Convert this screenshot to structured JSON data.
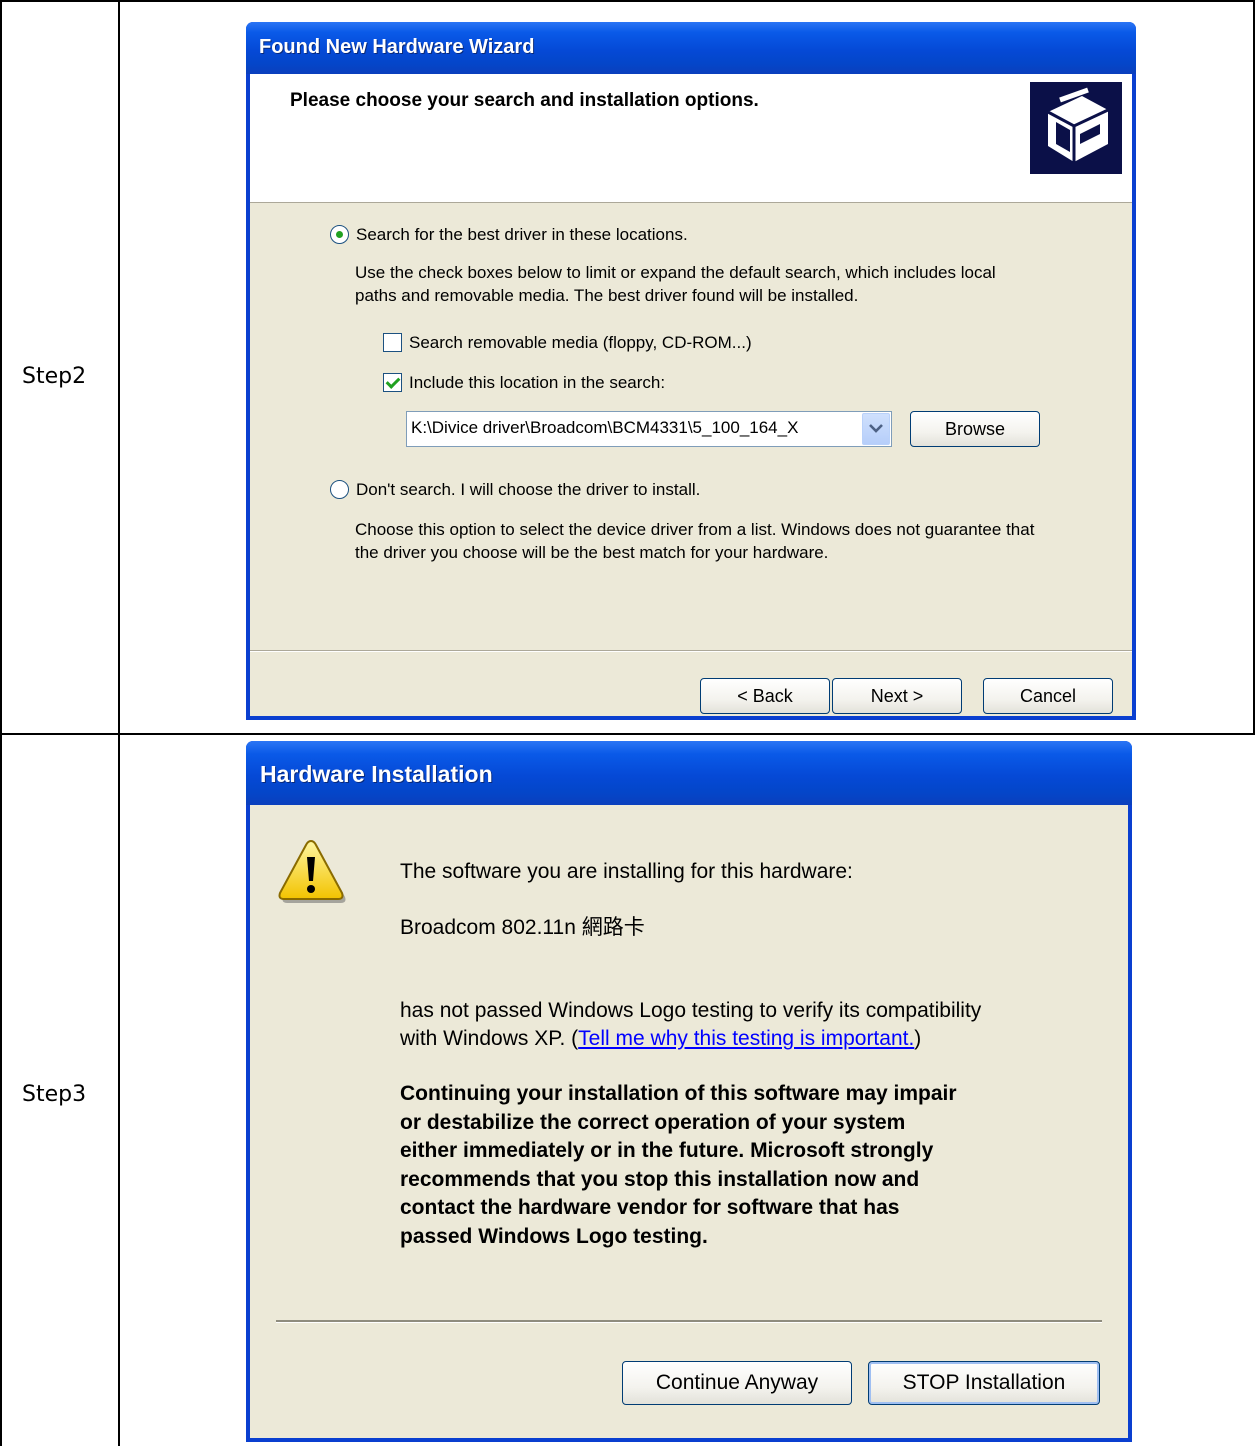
{
  "rows": [
    {
      "label": "Step2"
    },
    {
      "label": "Step3"
    }
  ],
  "wizard": {
    "title": "Found New Hardware Wizard",
    "header_title": "Please choose your search and installation options.",
    "option_search": {
      "label": "Search for the best driver in these locations.",
      "selected": true,
      "description_line1": "Use the check boxes below to limit or expand the default search, which includes local",
      "description_line2": "paths and removable media. The best driver found will be installed."
    },
    "checkbox_removable": {
      "label": "Search removable media (floppy, CD-ROM...)",
      "checked": false
    },
    "checkbox_location": {
      "label": "Include this location in the search:",
      "checked": true
    },
    "location_value": "K:\\Divice driver\\Broadcom\\BCM4331\\5_100_164_X",
    "browse_label": "Browse",
    "option_dont_search": {
      "label": "Don't search. I will choose the driver to install.",
      "selected": false,
      "description_line1": "Choose this option to select the device driver from a list.  Windows does not guarantee that",
      "description_line2": "the driver you choose will be the best match for your hardware."
    },
    "buttons": {
      "back": "< Back",
      "next": "Next >",
      "cancel": "Cancel"
    }
  },
  "hw_install": {
    "title": "Hardware Installation",
    "line_intro": "The software you are installing for this hardware:",
    "device_name": "Broadcom 802.11n 網路卡",
    "warning_line1": "has not passed Windows Logo testing to verify its compatibility",
    "warning_line2_prefix": "with Windows XP. (",
    "warning_link": "Tell me why this testing is important.",
    "warning_line2_suffix": ")",
    "bold_lines": [
      "Continuing your installation of this software may impair",
      "or destabilize the correct operation of your system",
      "either immediately or in the future. Microsoft strongly",
      "recommends that you stop this installation now and",
      "contact the hardware vendor for software that has",
      "passed Windows Logo testing."
    ],
    "buttons": {
      "continue": "Continue Anyway",
      "stop": "STOP Installation"
    }
  },
  "colors": {
    "titlebar": "#0549d6",
    "dialog_face": "#ece9d8",
    "link": "#0000ff",
    "check_green": "#21a121"
  }
}
